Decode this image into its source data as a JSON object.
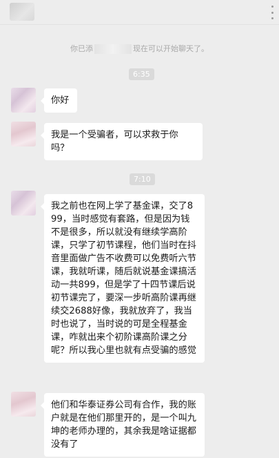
{
  "header": {
    "avatar_icon": "contact-avatar",
    "menu_icon": "more-vertical-icon"
  },
  "system_notice": {
    "prefix": "你已添",
    "suffix": "现在可以开始聊天了。"
  },
  "timestamps": [
    "6:35",
    "7:10"
  ],
  "messages": [
    {
      "sender": "contact",
      "text": "你好"
    },
    {
      "sender": "contact",
      "text": "我是一个受骗者，可以求救于你吗？"
    },
    {
      "sender": "contact",
      "text": "我之前也在网上学了基金课，交了899，当时感觉有套路，但是因为钱不是很多，所以就没有继续学高阶课，只学了初节课程，他们当时在抖音里面做广告不收费可以免费听六节课，我就听课，随后就说基金课搞活动一共899，但是学了十四节课后说初节课完了，要深一步听高阶课再继续交2688好像，我就放弃了，我当时也说了，当时说的可是全程基金课，咋就出来个初阶课高阶课之分呢？所以我心里也就有点受骗的感觉"
    },
    {
      "sender": "contact",
      "text": "他们和华泰证券公司有合作，我的账户就是在他们那里开的，是一个叫九坤的老师办理的，其余我是啥证据都没有了"
    }
  ]
}
